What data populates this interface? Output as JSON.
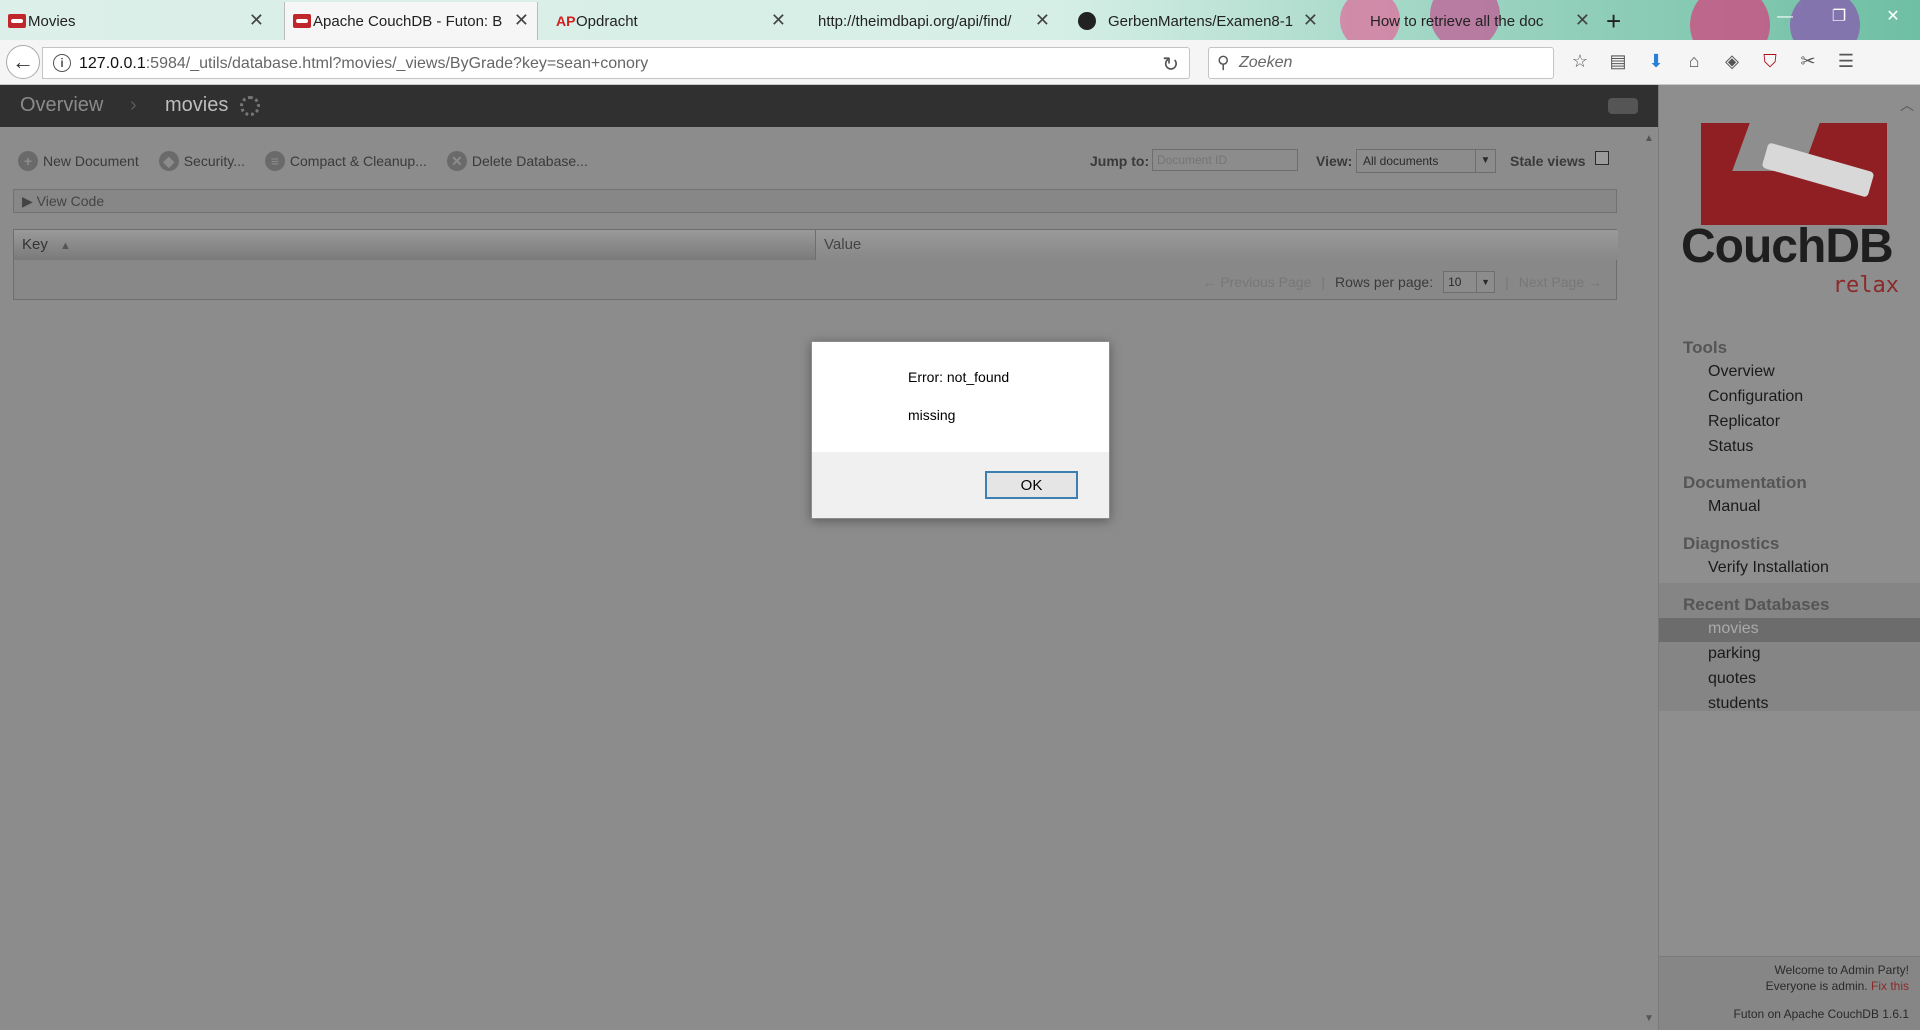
{
  "browser": {
    "tabs": [
      {
        "title": "Movies"
      },
      {
        "title": "Apache CouchDB - Futon: Br"
      },
      {
        "title": "Opdracht"
      },
      {
        "title": "http://theimdbapi.org/api/find/"
      },
      {
        "title": "GerbenMartens/Examen8-1"
      },
      {
        "title": "How to retrieve all the doc"
      }
    ],
    "url_host": "127.0.0.1",
    "url_rest": ":5984/_utils/database.html?movies/_views/ByGrade?key=sean+conory",
    "search_placeholder": "Zoeken"
  },
  "futon": {
    "breadcrumb": {
      "overview": "Overview",
      "separator": "›",
      "database": "movies"
    },
    "actions": {
      "new_document": "New Document",
      "security": "Security...",
      "compact": "Compact & Cleanup...",
      "delete": "Delete Database..."
    },
    "jump_to_label": "Jump to:",
    "jump_to_placeholder": "Document ID",
    "view_label": "View:",
    "view_selected": "All documents",
    "stale_views_label": "Stale views",
    "view_code_label": "View Code",
    "table": {
      "key_header": "Key",
      "value_header": "Value"
    },
    "pager": {
      "previous": "← Previous Page",
      "rows_per_page_label": "Rows per page:",
      "rows_per_page_value": "10",
      "next": "Next Page →"
    }
  },
  "sidebar": {
    "logo_text": "CouchDB",
    "logo_tagline": "relax",
    "tools_heading": "Tools",
    "tools": [
      "Overview",
      "Configuration",
      "Replicator",
      "Status"
    ],
    "documentation_heading": "Documentation",
    "documentation": [
      "Manual"
    ],
    "diagnostics_heading": "Diagnostics",
    "diagnostics": [
      "Verify Installation"
    ],
    "recent_heading": "Recent Databases",
    "recent": [
      "movies",
      "parking",
      "quotes",
      "students"
    ],
    "welcome_line1": "Welcome to Admin Party!",
    "welcome_line2": "Everyone is admin.",
    "fix_link": "Fix this",
    "version": "Futon on Apache CouchDB 1.6.1"
  },
  "dialog": {
    "error": "Error: not_found",
    "reason": "missing",
    "ok_label": "OK"
  }
}
